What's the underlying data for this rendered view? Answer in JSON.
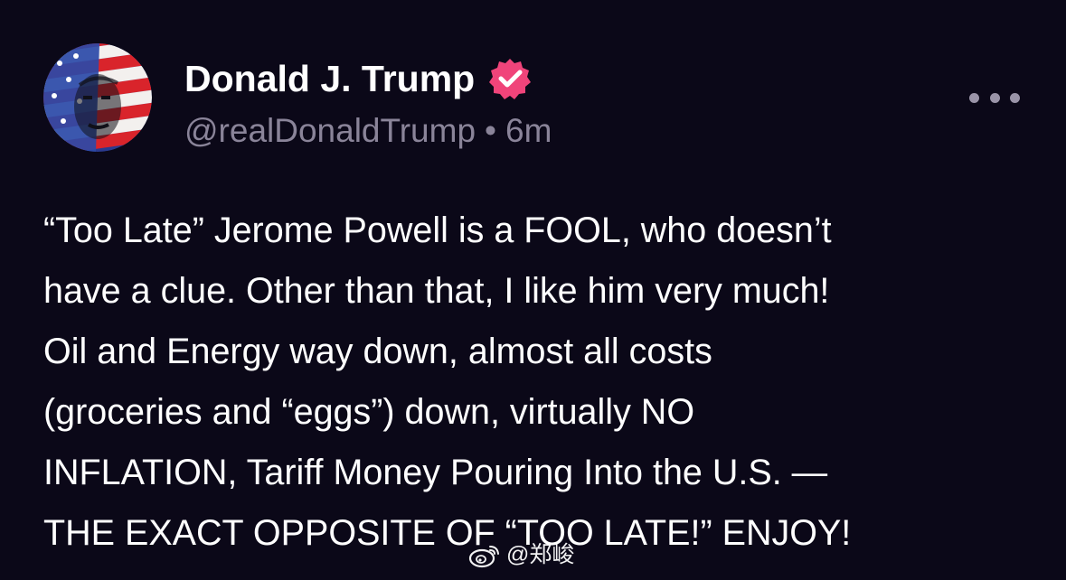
{
  "author": {
    "name": "Donald J. Trump",
    "handle": "@realDonaldTrump",
    "separator": "•",
    "time": "6m"
  },
  "post": {
    "lines": [
      "“Too Late” Jerome Powell is a FOOL, who doesn’t",
      "have a clue. Other than that, I like him very much!",
      "Oil and Energy way down, almost all costs",
      "(groceries and “eggs”) down, virtually NO",
      "INFLATION, Tariff Money Pouring Into the U.S. —",
      "THE EXACT OPPOSITE OF “TOO LATE!” ENJOY!"
    ]
  },
  "watermark": {
    "text": "@郑峻",
    "logo": "weibo-logo"
  },
  "icons": {
    "verified": "verified-badge-icon",
    "more": "more-options-icon"
  },
  "colors": {
    "background": "#0b0818",
    "text": "#ffffff",
    "meta": "#8a8499",
    "verified": "#f0447a"
  }
}
